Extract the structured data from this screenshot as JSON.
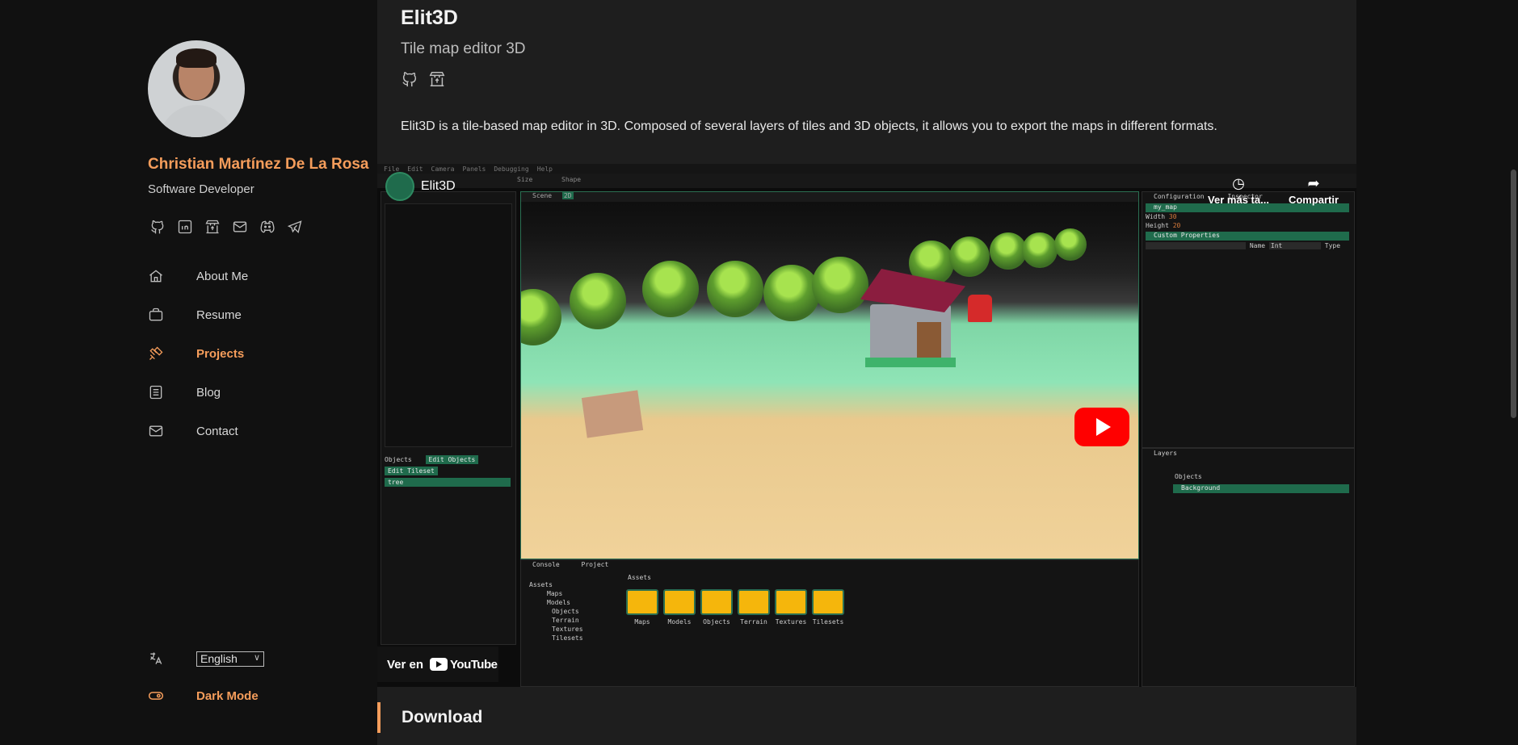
{
  "profile": {
    "name": "Christian Martínez De La Rosa",
    "role": "Software Developer"
  },
  "socials": [
    {
      "icon": "github-icon"
    },
    {
      "icon": "linkedin-icon"
    },
    {
      "icon": "store-icon"
    },
    {
      "icon": "mail-icon"
    },
    {
      "icon": "discord-icon"
    },
    {
      "icon": "telegram-icon"
    }
  ],
  "nav": {
    "items": [
      {
        "label": "About Me",
        "icon": "home-icon",
        "active": false
      },
      {
        "label": "Resume",
        "icon": "briefcase-icon",
        "active": false
      },
      {
        "label": "Projects",
        "icon": "tools-icon",
        "active": true
      },
      {
        "label": "Blog",
        "icon": "list-icon",
        "active": false
      },
      {
        "label": "Contact",
        "icon": "mail-icon",
        "active": false
      }
    ]
  },
  "language": {
    "selected": "English",
    "icon": "translate-icon"
  },
  "theme": {
    "label": "Dark Mode",
    "icon": "toggle-icon"
  },
  "colors": {
    "accent": "#f59d5b",
    "background": "#111111",
    "panel": "#1e1e1e"
  },
  "project": {
    "title": "Elit3D",
    "subtitle": "Tile map editor 3D",
    "description": "Elit3D is a tile-based map editor in 3D. Composed of several layers of tiles and 3D objects, it allows you to export the maps in different formats."
  },
  "video": {
    "channel": "Elit3D",
    "watch_later": "Ver más ta...",
    "share": "Compartir",
    "watch_on": "Ver en",
    "youtube": "YouTube",
    "editor": {
      "menu": [
        "File",
        "Edit",
        "Camera",
        "Panels",
        "Debugging",
        "Help"
      ],
      "size_label": "Size",
      "shape_label": "Shape",
      "scene_tab": "Scene",
      "scene_mode": "2D",
      "objects_tab": "Objects",
      "edit_objects": "Edit Objects",
      "edit_tileset": "Edit Tileset",
      "selected_object": "tree",
      "config_tab": "Configuration",
      "inspector_tab": "Inspector",
      "map_name": "my_map",
      "width_label": "Width",
      "width_value": "30",
      "height_label": "Height",
      "height_value": "20",
      "custom_props": "Custom Properties",
      "name_label": "Name",
      "type_value": "Int",
      "type_label": "Type",
      "layers_tab": "Layers",
      "layers": [
        "Objects",
        "Background"
      ],
      "console_tab": "Console",
      "project_tab": "Project",
      "assets_root": "Assets",
      "asset_tree": [
        "Maps",
        "Models",
        "Objects",
        "Terrain",
        "Textures",
        "Tilesets"
      ],
      "assets_header": "Assets",
      "folders": [
        "Maps",
        "Models",
        "Objects",
        "Terrain",
        "Textures",
        "Tilesets"
      ]
    }
  },
  "section": {
    "download": "Download"
  }
}
